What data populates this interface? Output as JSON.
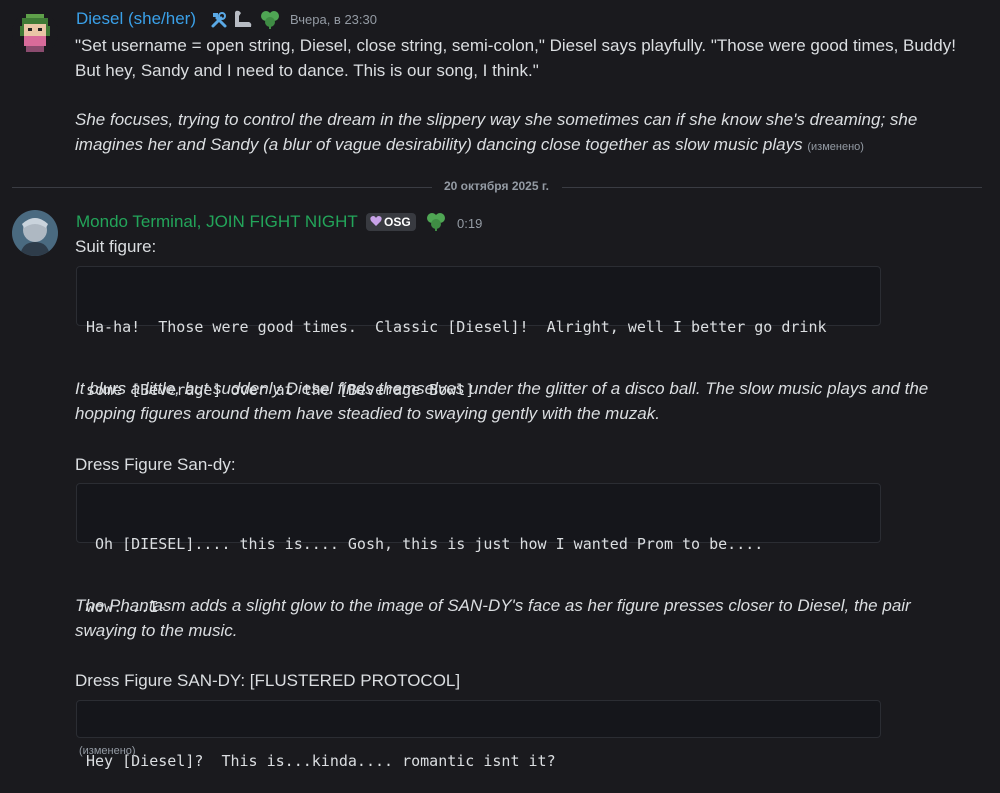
{
  "messages": {
    "first": {
      "author": "Diesel",
      "pronouns": "(she/her)",
      "timestamp": "Вчера, в 23:30",
      "author_color": "#3aa0e8",
      "icons": [
        "tools-icon",
        "flexed-arm-icon",
        "clover-icon"
      ],
      "lines": [
        "\"Set username = open string, Diesel, close string, semi-colon,\" Diesel says playfully. \"Those were good times, Buddy!",
        "But hey, Sandy and I need to dance. This is our song, I think.\"",
        "She focuses, trying to control the dream in the slippery way she sometimes can if she know she's dreaming; she",
        "imagines her and Sandy (a blur of vague desirability) dancing close together as slow music plays"
      ],
      "edited": "(изменено)"
    },
    "date_divider": "20 октября 2025 г.",
    "second": {
      "author": "Mondo Terminal, JOIN FIGHT NIGHT",
      "author_color": "#23a55a",
      "badge": "OSG",
      "timestamp": "0:19",
      "icons": [
        "heart-badge-icon",
        "clover-icon"
      ],
      "suit_label": "Suit figure:",
      "code1": [
        "Ha-ha!  Those were good times.  Classic [Diesel]!  Alright, well I better go drink",
        "some [Beverage] over at the [Beverage Bowl]"
      ],
      "narration1": [
        "It blurs a little, but suddenly Diesel finds themselves under the glitter of a disco ball.  The slow music plays and the",
        "hopping figures around them have steadied to swaying gently with the muzak."
      ],
      "dress_label_1": "Dress Figure San-dy:",
      "code2": [
        " Oh [DIESEL].... this is.... Gosh, this is just how I wanted Prom to be....",
        "wow....I-"
      ],
      "narration2": [
        "The Phantasm adds a slight glow to the image of SAN-DY's face as her figure presses closer to Diesel, the pair",
        "swaying to the music."
      ],
      "dress_label_2": "Dress Figure SAN-DY: [FLUSTERED PROTOCOL]",
      "code3": "Hey [Diesel]?  This is...kinda.... romantic isnt it?",
      "edited": "(изменено)"
    }
  }
}
